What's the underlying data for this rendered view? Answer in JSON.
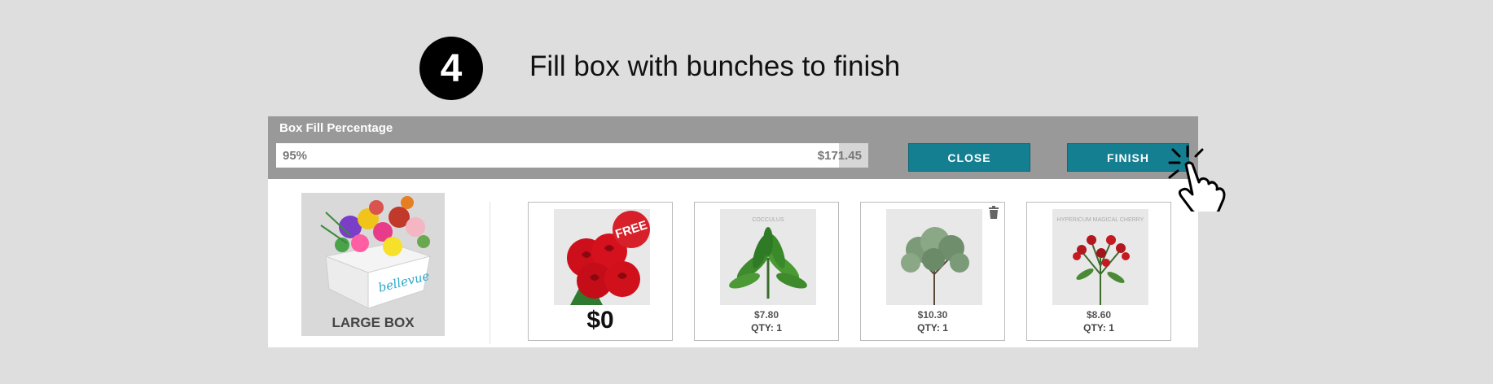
{
  "step": {
    "number": "4",
    "title": "Fill box with bunches to finish"
  },
  "panel": {
    "fill_label": "Box Fill Percentage",
    "progress": {
      "percent_text": "95%",
      "percent_value": 0.95,
      "total": "$171.45"
    },
    "buttons": {
      "close": "CLOSE",
      "finish": "FINISH"
    }
  },
  "box": {
    "label": "LARGE BOX",
    "brand": "bellevue"
  },
  "products": [
    {
      "badge": "FREE",
      "price": "$0"
    },
    {
      "caption": "COCCULUS",
      "price": "$7.80",
      "qty": "QTY: 1"
    },
    {
      "caption": "",
      "price": "$10.30",
      "qty": "QTY: 1"
    },
    {
      "caption": "HYPERICUM MAGICAL CHERRY",
      "price": "$8.60",
      "qty": "QTY: 1"
    }
  ],
  "icons": [
    "trash-icon",
    "pointer-hand-icon"
  ],
  "colors": {
    "accent": "#157f92",
    "header": "#999999",
    "badge": "#d8202a"
  }
}
